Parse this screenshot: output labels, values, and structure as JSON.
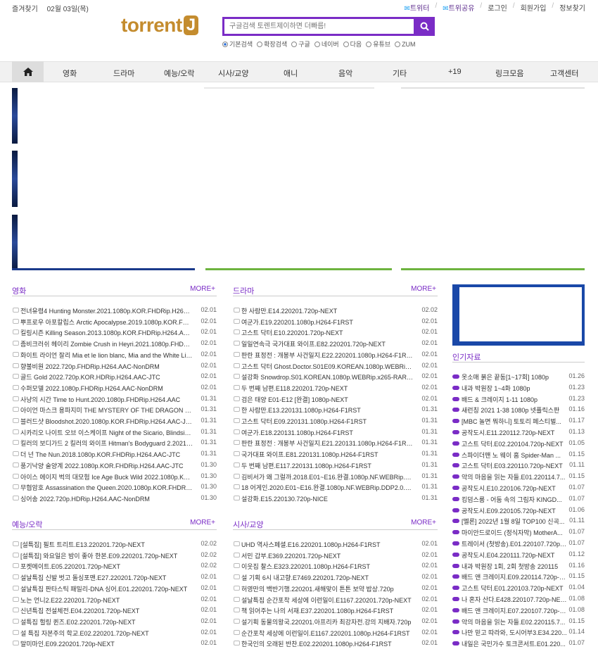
{
  "topbar": {
    "favorites": "즐겨찾기",
    "date": "02월 03일(목)",
    "twitter": "트위터",
    "share": "트위공유",
    "login": "로그인",
    "signup": "회원가입",
    "findinfo": "정보찾기"
  },
  "logo": {
    "main": "torrent",
    "j": "J"
  },
  "search": {
    "placeholder": "구글검색 토렌트제이하면 더빠름!"
  },
  "radios": [
    "기본검색",
    "확장검색",
    "구글",
    "네이버",
    "다음",
    "유튜브",
    "ZUM"
  ],
  "nav": [
    "영화",
    "드라마",
    "예능/오락",
    "시사/교양",
    "애니",
    "음악",
    "기타",
    "+19",
    "링크모음",
    "고객센터"
  ],
  "more": "MORE+",
  "movie": {
    "title": "영화",
    "rows": [
      [
        "전녀유령4 Hunting Monster.2021.1080p.KOR.FHDRip.H264.AAC...",
        "02.01"
      ],
      [
        "뿌프로우 아포칼립스 Arctic Apocalypse.2019.1080p.KOR.FHDRi...",
        "02.01"
      ],
      [
        "킬링시즌 Killing Season.2013.1080p.KOR.FHDRip.H264.AAC-JTC",
        "02.01"
      ],
      [
        "좀비크러쉬 헤이리 Zombie Crush in Heyri.2021.1080p.FHDRip....",
        "02.01"
      ],
      [
        "화이트 라이언 잘리 Mia et le lion blanc, Mia and the White Lio...",
        "02.01"
      ],
      [
        "향불비원 2022.720p.FHDRip.H264.AAC-NonDRM",
        "02.01"
      ],
      [
        "골드 Gold 2022.720p.KOR.HDRip.H264.AAC-JTC",
        "02.01"
      ],
      [
        "수퍼모델 2022.1080p.FHDRip.H264.AAC-NonDRM",
        "02.01"
      ],
      [
        "사냥의 시간 Time to Hunt.2020.1080p.FHDRip.H264.AAC",
        "01.31"
      ],
      [
        "아이언 마스크 용파지미 THE MYSTERY OF THE DRAGON SEAL...",
        "01.31"
      ],
      [
        "블러드샷 Bloodshot.2020.1080p.KOR.FHDRip.H264.AAC-JTC",
        "01.31"
      ],
      [
        "시카리오 나이트 오브 이스케이프 Night of the Sicario, Blindsid...",
        "01.31"
      ],
      [
        "킬러의 보디가드 2 킬러의 와이프 Hitman's Bodyguard 2.2021.1...",
        "01.31"
      ],
      [
        "더 넌 The Nun.2018.1080p.KOR.FHDRip.H264.AAC-JTC",
        "01.31"
      ],
      [
        "풍기낙양 술양계 2022.1080p.KOR.FHDRip.H264.AAC-JTC",
        "01.30"
      ],
      [
        "아이스 에이지 벅의 대모험 Ice Age Buck Wild 2022.1080p.KOR....",
        "01.30"
      ],
      [
        "무협암호 Assassination the Queen.2020.1080p.KOR.FHDRip.H26...",
        "01.30"
      ],
      [
        "싱어송 2022.720p.HDRip.H264.AAC-NonDRM",
        "01.30"
      ]
    ]
  },
  "drama": {
    "title": "드라마",
    "rows": [
      [
        "한 사람만.E14.220201.720p-NEXT",
        "02.02"
      ],
      [
        "여군가.E19.220201.1080p.H264-F1RST",
        "02.01"
      ],
      [
        "고스트 닥터.E10.220201.720p-NEXT",
        "02.01"
      ],
      [
        "일일연속극 국가대표 와이프.E82.220201.720p-NEXT",
        "02.01"
      ],
      [
        "판란 표정전 : 개봉부 사건일지.E22.220201.1080p.H264-F1RST",
        "02.01"
      ],
      [
        "고스트 닥터 Ghost.Doctor.S01E09.KOREAN.1080p.WEBRip.AAC2...",
        "02.01"
      ],
      [
        "설강화 Snowdrop.S01.KOREAN.1080p.WEBRip.x265-RARBG",
        "02.01"
      ],
      [
        "두 번째 남편.E118.220201.720p-NEXT",
        "02.01"
      ],
      [
        "검은 태양 E01-E12 [완결] 1080p-NEXT",
        "02.01"
      ],
      [
        "한 사람만.E13.220131.1080p.H264-F1RST",
        "01.31"
      ],
      [
        "고스트 닥터.E09.220131.1080p.H264-F1RST",
        "01.31"
      ],
      [
        "여군가.E18.220131.1080p.H264-F1RST",
        "01.31"
      ],
      [
        "판란 표정전 : 개봉부 사건일지.E21.220131.1080p.H264-F1RST",
        "01.31"
      ],
      [
        "국가대표 와이프.E81.220131.1080p.H264-F1RST",
        "01.31"
      ],
      [
        "두 번째 남편.E117.220131.1080p.H264-F1RST",
        "01.31"
      ],
      [
        "김비서가 왜 그럴까.2018.E01~E16.완결.1080p.NF.WEBRip.DDP2...",
        "01.31"
      ],
      [
        "18 어게인.2020.E01~E16.완결.1080p.NF.WEBRip.DDP2.0.x264-l...",
        "01.31"
      ],
      [
        "설강화.E15.220130.720p-NICE",
        "01.31"
      ]
    ]
  },
  "variety": {
    "title": "예능/오락",
    "rows": [
      [
        "[설특집] 필트 트리트.E13.220201.720p-NEXT",
        "02.02"
      ],
      [
        "[설특집] 와요일은 밤이 좋아 한본.E09.220201.720p-NEXT",
        "02.02"
      ],
      [
        "포켓메이트.E05.220201.720p-NEXT",
        "02.02"
      ],
      [
        "설날특집 신발 벗고 돌싱포맨.E27.220201.720p-NEXT",
        "02.01"
      ],
      [
        "설날특집 판타스틱 패밀리-DNA 싱어.E01.220201.720p-NEXT",
        "02.01"
      ],
      [
        "노는 언니2.E22.220201.720p-NEXT",
        "02.01"
      ],
      [
        "신년특집 전설체전.E04.220201.720p-NEXT",
        "02.01"
      ],
      [
        "설특집 헐링 퀸즈.E02.220201.720p-NEXT",
        "02.01"
      ],
      [
        "설 특집 자본주의 학교.E02.220201.720p-NEXT",
        "02.01"
      ],
      [
        "말미마인.E09.220201.720p-NEXT",
        "02.01"
      ]
    ]
  },
  "current": {
    "title": "시사/교양",
    "rows": [
      [
        "UHD 역사스페셜.E16.220201.1080p.H264-F1RST",
        "02.01"
      ],
      [
        "서민 갑부.E369.220201.720p-NEXT",
        "02.01"
      ],
      [
        "이웃집 찰스.E323.220201.1080p.H264-F1RST",
        "02.01"
      ],
      [
        "설 기획 6시 내고향.E7469.220201.720p-NEXT",
        "02.01"
      ],
      [
        "허영만의 백반기행.220201.새해맞이 튼튼 보약 밥상.720p",
        "02.01"
      ],
      [
        "설날특집 순간포착 세상에 이런일이.E1167.220201.720p-NEXT",
        "02.01"
      ],
      [
        "책 읽어주는 나의 서재.E37.220201.1080p.H264-F1RST",
        "02.01"
      ],
      [
        "설기획 동물의왕국.220201.아프리카 최강자전.강의 지배자.720p",
        "02.01"
      ],
      [
        "순간포착 세상에 이런일이.E1167.220201.1080p.H264-F1RST",
        "02.01"
      ],
      [
        "한국인의 오래된 반찬.E02.220201.1080p.H264-F1RST",
        "02.01"
      ]
    ]
  },
  "popular": {
    "title": "인기자료",
    "rows": [
      [
        "옷소매 붉은 끝동[1~17회] 1080p",
        "01.26"
      ],
      [
        "내과 박원장 1~4화 1080p",
        "01.23"
      ],
      [
        "배드 & 크레이지 1-11 1080p",
        "01.23"
      ],
      [
        "새런칭 2021 1-38 1080p 넷플릭스판",
        "01.16"
      ],
      [
        "[MBC 놀면 뭐하니] 토토리 페스티벌...",
        "01.17"
      ],
      [
        "공작도시.E11.220112.720p-NEXT",
        "01.13"
      ],
      [
        "고스트 닥터.E02.220104.720p-NEXT",
        "01.05"
      ],
      [
        "스파이더맨 노 웨이 홈 Spider-Man ...",
        "01.15"
      ],
      [
        "고스트 닥터.E03.220110.720p-NEXT",
        "01.11"
      ],
      [
        "악의 마음을 읽는 자들.E01.220114.7...",
        "01.15"
      ],
      [
        "공작도시.E10.220106.720p-NEXT",
        "01.07"
      ],
      [
        "킹덤스룸 - 어둠 속의 그림자 KINGD...",
        "01.07"
      ],
      [
        "공작도시.E09.220105.720p-NEXT",
        "01.06"
      ],
      [
        "[멜론] 2022년 1월 8일 TOP100 신곡...",
        "01.11"
      ],
      [
        "마이안드로이드 (정식자막) MotherA...",
        "01.07"
      ],
      [
        "트레이서 (첫방송).E01.220107.720p-...",
        "01.07"
      ],
      [
        "공작도시.E04.220111.720p-NEXT",
        "01.12"
      ],
      [
        "내과 박원장 1회, 2회 첫방송 220115",
        "01.16"
      ],
      [
        "배드 앤 크레이지.E09.220114.720p-N...",
        "01.15"
      ],
      [
        "고스트 닥터.E01.220103.720p-NEXT",
        "01.04"
      ],
      [
        "나 혼자 산다.E428.220107.720p-NEXT",
        "01.08"
      ],
      [
        "배드 앤 크레이지.E07.220107.720p-N...",
        "01.08"
      ],
      [
        "악의 마음을 읽는 자들.E02.220115.7...",
        "01.15"
      ],
      [
        "나만 믿고 따라와, 도시어부3.E34.220...",
        "01.14"
      ],
      [
        "내일은 국민가수 토크콘서트.E01.220...",
        "01.07"
      ]
    ]
  }
}
